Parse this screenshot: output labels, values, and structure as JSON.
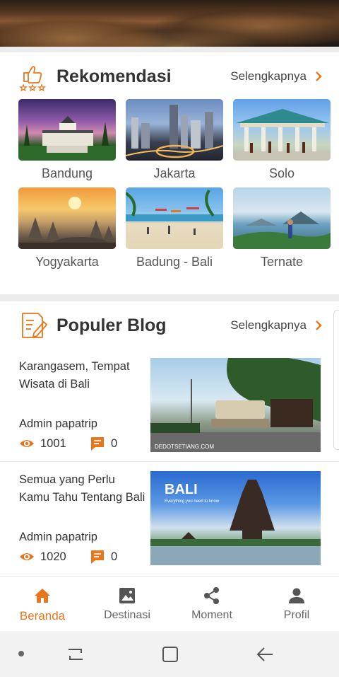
{
  "colors": {
    "accent": "#e8761c",
    "text": "#333333",
    "muted": "#666666"
  },
  "recommend": {
    "title": "Rekomendasi",
    "more_label": "Selengkapnya",
    "icon": "thumbs-up-stars-icon",
    "cities": [
      {
        "name": "Bandung"
      },
      {
        "name": "Jakarta"
      },
      {
        "name": "Solo"
      },
      {
        "name": "Yogyakarta"
      },
      {
        "name": "Badung - Bali"
      },
      {
        "name": "Ternate"
      }
    ]
  },
  "blog": {
    "title": "Populer Blog",
    "more_label": "Selengkapnya",
    "icon": "blog-edit-icon",
    "posts": [
      {
        "title": "Karangasem, Tempat Wisata di Bali",
        "author": "Admin papatrip",
        "views": "1001",
        "comments": "0",
        "image_caption": "DEDOTSETIANG.COM"
      },
      {
        "title": "Semua yang Perlu Kamu Tahu Tentang Bali",
        "author": "Admin papatrip",
        "views": "1020",
        "comments": "0",
        "image_caption": "BALI",
        "image_subcaption": "Everything you need to know"
      }
    ]
  },
  "nav": [
    {
      "label": "Beranda",
      "icon": "home-icon",
      "active": true
    },
    {
      "label": "Destinasi",
      "icon": "image-icon",
      "active": false
    },
    {
      "label": "Moment",
      "icon": "share-icon",
      "active": false
    },
    {
      "label": "Profil",
      "icon": "person-icon",
      "active": false
    }
  ]
}
